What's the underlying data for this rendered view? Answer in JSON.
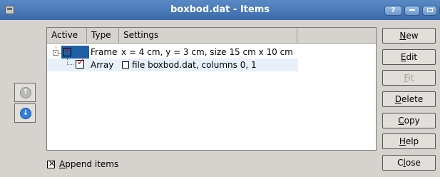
{
  "window": {
    "title": "boxbod.dat - Items",
    "help_label": "?"
  },
  "tree": {
    "columns": [
      "Active",
      "Type",
      "Settings"
    ],
    "rows": [
      {
        "type": "Frame",
        "settings": "x = 4 cm, y = 3 cm, size 15 cm x 10 cm"
      },
      {
        "type": "Array",
        "settings": "file boxbod.dat, columns 0, 1"
      }
    ]
  },
  "buttons": {
    "new": {
      "u": "N",
      "rest": "ew"
    },
    "edit": {
      "u": "E",
      "rest": "dit"
    },
    "fit": {
      "u": "F",
      "rest": "it"
    },
    "delete": {
      "u": "D",
      "rest": "elete"
    },
    "copy": {
      "u": "C",
      "rest": "opy"
    },
    "help": {
      "u": "H",
      "rest": "elp"
    },
    "close": {
      "pre": "C",
      "u": "l",
      "rest": "ose"
    }
  },
  "append_items": {
    "u": "A",
    "rest": "ppend items",
    "checked": true
  }
}
